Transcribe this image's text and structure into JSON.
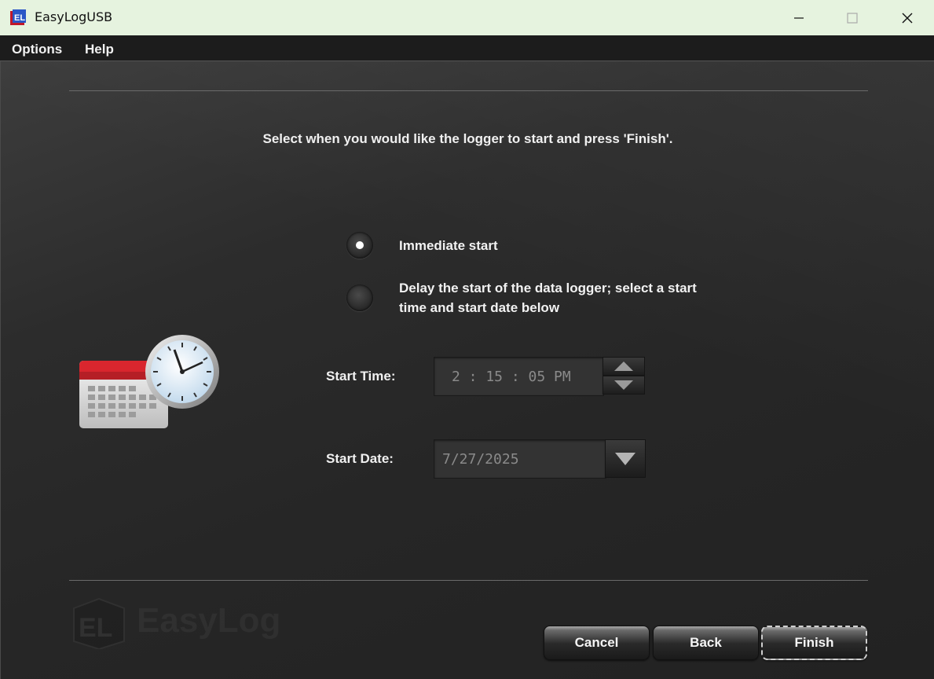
{
  "window": {
    "title": "EasyLogUSB"
  },
  "menu": {
    "items": [
      "Options",
      "Help"
    ]
  },
  "instruction": "Select when you would like the logger to start and press 'Finish'.",
  "start_options": [
    {
      "label": "Immediate start",
      "selected": true
    },
    {
      "label": "Delay the start of the data logger; select a start time and start date below",
      "selected": false
    }
  ],
  "start_time": {
    "label": "Start Time:",
    "value": "2 : 15 : 05 PM"
  },
  "start_date": {
    "label": "Start Date:",
    "value": "7/27/2025"
  },
  "logo": {
    "text": "EasyLog",
    "mark": "EL"
  },
  "buttons": {
    "cancel": "Cancel",
    "back": "Back",
    "finish": "Finish"
  }
}
